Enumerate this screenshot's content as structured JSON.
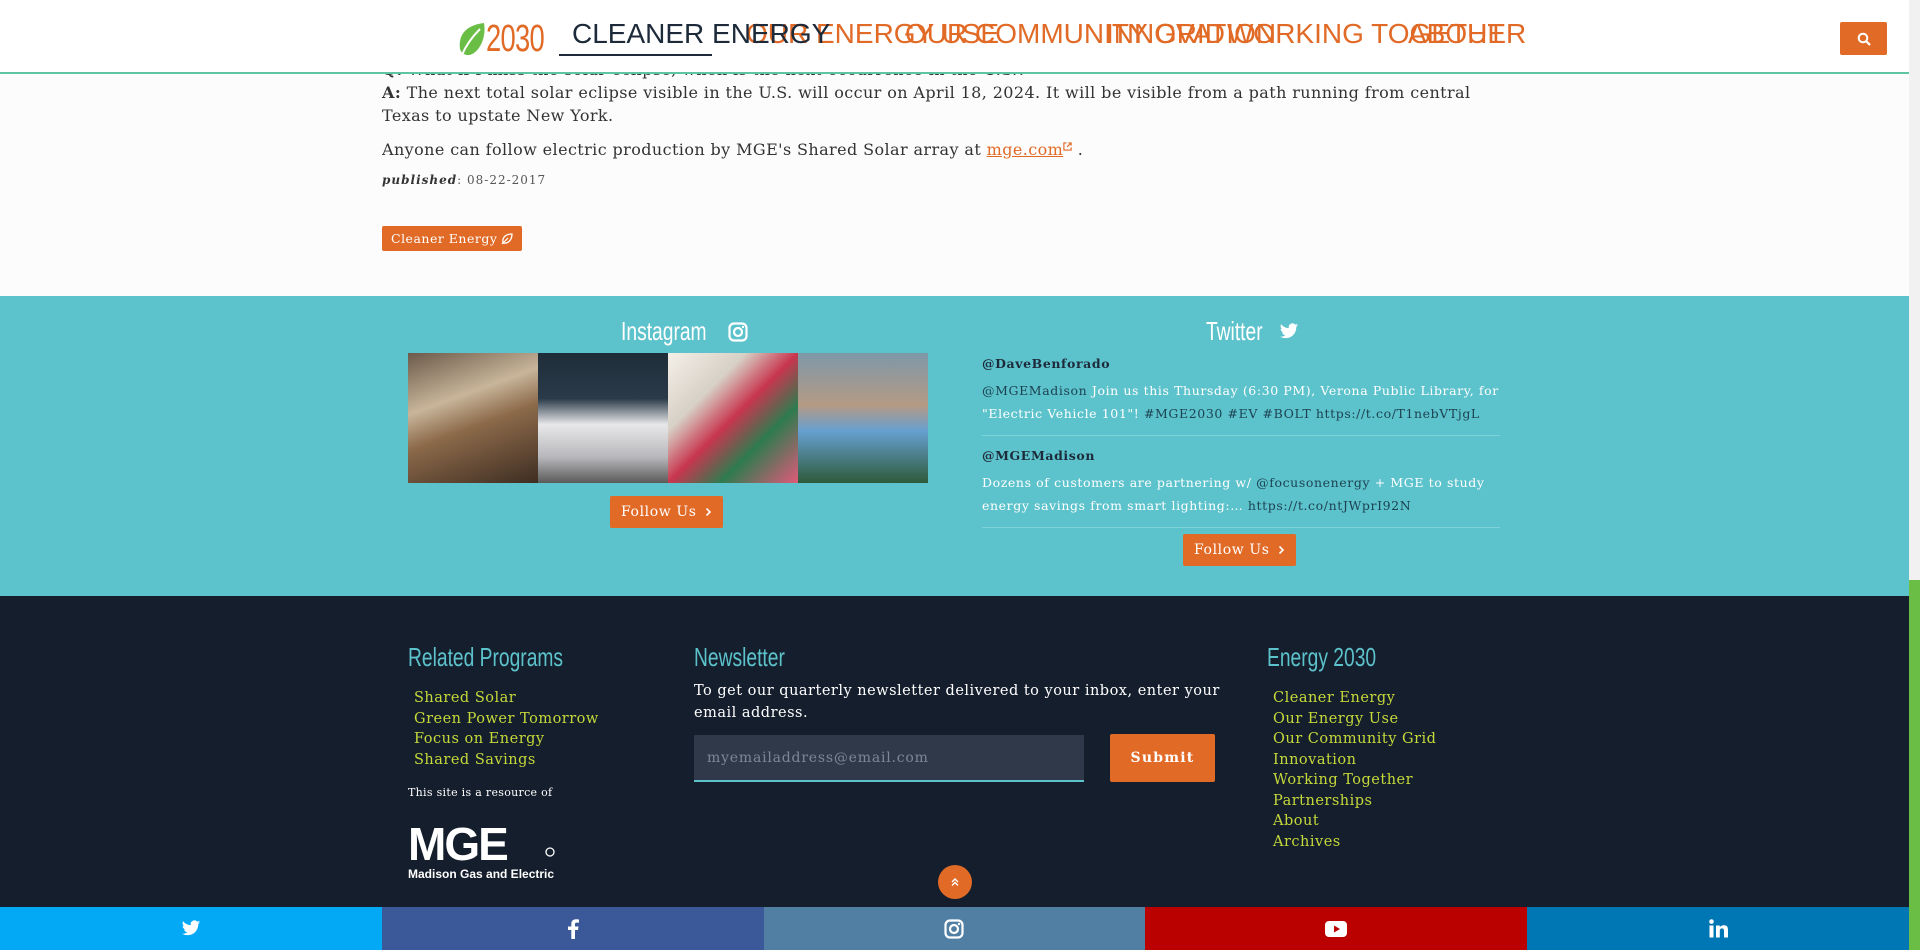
{
  "header": {
    "logo_text": "2030",
    "nav": [
      "CLEANER ENERGY",
      "OUR ENERGY USE",
      "OUR COMMUNITY GRID",
      "INNOVATION",
      "WORKING TOGETHER",
      "ABOUT"
    ],
    "active_index": 0,
    "search_icon": "search-icon"
  },
  "article": {
    "q_label": "Q:",
    "q_text": "What if I miss the solar eclipse, when is the next occurrence in the U.S.?",
    "a_label": "A:",
    "a_text": "The next total solar eclipse visible in the U.S. will occur on April 18, 2024. It will be visible from a path running from central Texas to upstate New York.",
    "follow_text": "Anyone can follow electric production by MGE's Shared Solar array at",
    "link_text": "mge.com",
    "follow_end": ".",
    "published_label": "published",
    "published_date": ": 08-22-2017",
    "tag": "Cleaner Energy"
  },
  "social": {
    "instagram_title": "Instagram",
    "twitter_title": "Twitter",
    "follow_label": "Follow Us",
    "tweets": [
      {
        "handle": "@DaveBenforado",
        "mention": "@MGEMadison",
        "text": "Join us this Thursday (6:30 PM), Verona Public Library, for \"Electric Vehicle 101\"!",
        "tags": "#MGE2030 #EV #BOLT",
        "url": "https://t.co/T1nebVTjgL"
      },
      {
        "handle": "@MGEMadison",
        "text1": "Dozens of customers are partnering w/",
        "mention": "@focusonenergy",
        "text2": "+ MGE to study energy savings from smart lighting:…",
        "url": "https://t.co/ntJWprI92N"
      }
    ]
  },
  "footer": {
    "related_title": "Related Programs",
    "related": [
      "Shared Solar",
      "Green Power Tomorrow",
      "Focus on Energy",
      "Shared Savings"
    ],
    "resource_text": "This site is a resource of",
    "mge_logo_text": "MGE",
    "mge_sub": "Madison Gas and Electric",
    "newsletter_title": "Newsletter",
    "newsletter_text": "To get our quarterly newsletter delivered to your inbox, enter your email address.",
    "email_placeholder": "myemailaddress@email.com",
    "submit_label": "Submit",
    "energy_title": "Energy 2030",
    "energy_links": [
      "Cleaner Energy",
      "Our Energy Use",
      "Our Community Grid",
      "Innovation",
      "Working Together",
      "Partnerships",
      "About",
      "Archives"
    ]
  },
  "share_bar": [
    {
      "icon": "twitter-icon",
      "color": "#03a9f4"
    },
    {
      "icon": "facebook-icon",
      "color": "#3b5998"
    },
    {
      "icon": "instagram-icon",
      "color": "#517fa4"
    },
    {
      "icon": "youtube-icon",
      "color": "#bb0000"
    },
    {
      "icon": "linkedin-icon",
      "color": "#0077b5"
    }
  ],
  "colors": {
    "accent": "#e06a26",
    "teal": "#5cc2cb",
    "navy": "#151e2c",
    "lime": "#c5d93a"
  }
}
